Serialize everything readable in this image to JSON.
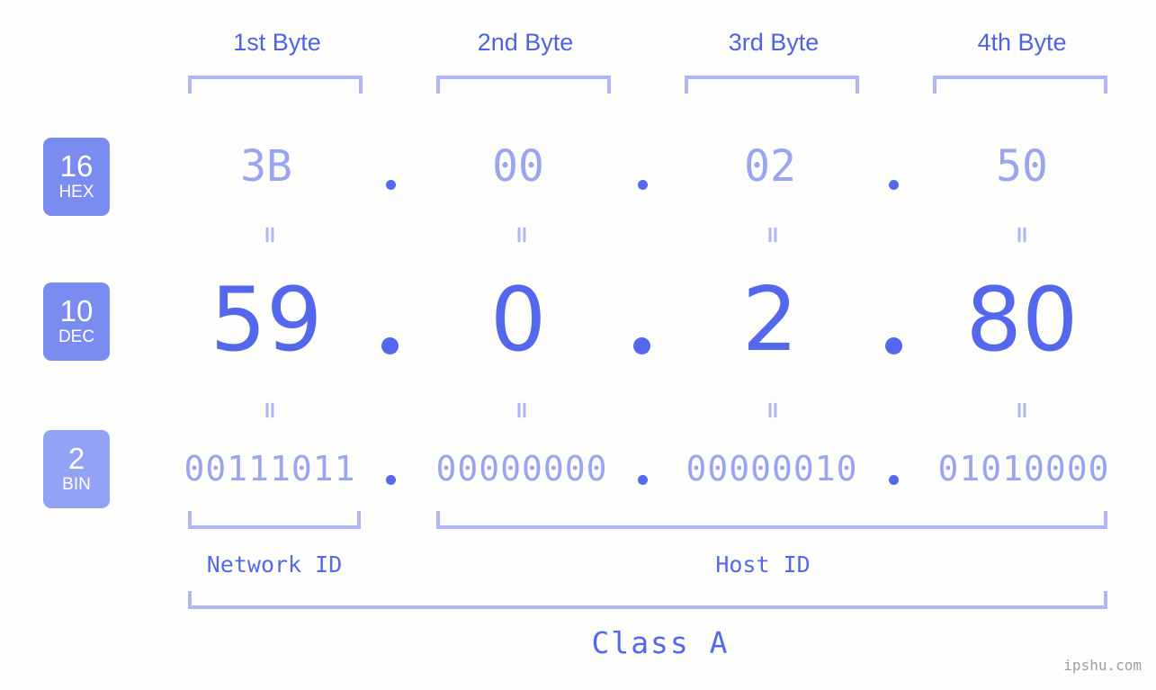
{
  "background_color": "#fdfefb",
  "colors": {
    "accent_strong": "#5468ee",
    "accent_light": "#9aa5f2",
    "bracket": "#aeb6f7",
    "header_text": "#4d63e4",
    "badge_hex": "#7b8cf0",
    "badge_dec": "#7b8cf0",
    "badge_bin": "#92a2f5",
    "watermark": "#9e9e9e"
  },
  "header": {
    "byte_labels": [
      "1st Byte",
      "2nd Byte",
      "3rd Byte",
      "4th Byte"
    ]
  },
  "rows": [
    {
      "base_number": "16",
      "base_name": "HEX",
      "values": [
        "3B",
        "00",
        "02",
        "50"
      ],
      "separator": "."
    },
    {
      "base_number": "10",
      "base_name": "DEC",
      "values": [
        "59",
        "0",
        "2",
        "80"
      ],
      "separator": "."
    },
    {
      "base_number": "2",
      "base_name": "BIN",
      "values": [
        "00111011",
        "00000000",
        "00000010",
        "01010000"
      ],
      "separator": "."
    }
  ],
  "equals_symbol": "=",
  "footer": {
    "network_id_label": "Network ID",
    "host_id_label": "Host ID",
    "class_label": "Class A"
  },
  "watermark": "ipshu.com"
}
